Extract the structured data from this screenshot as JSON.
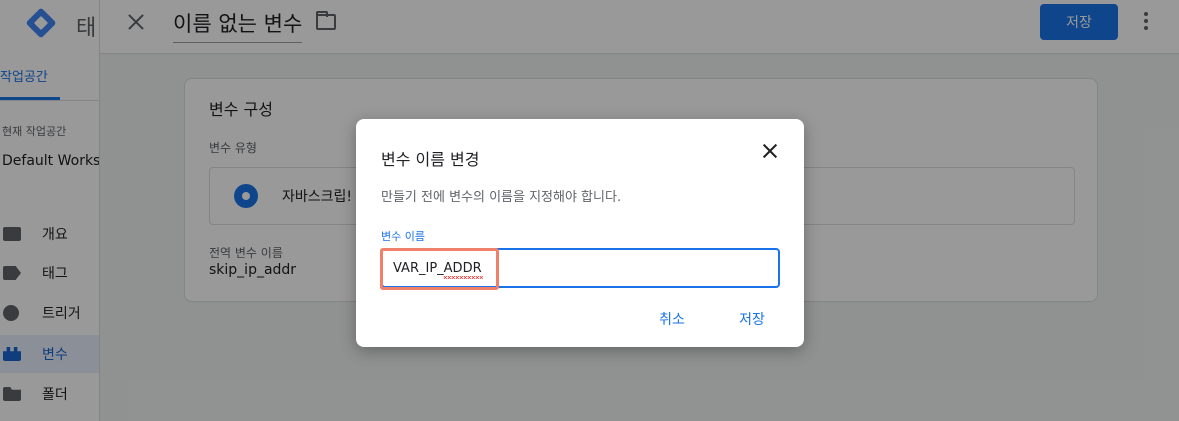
{
  "sidebar": {
    "title": "태",
    "workspace_tab": "작업공간",
    "current_workspace_label": "현재 작업공간",
    "workspace_name": "Default Worksp",
    "items": [
      {
        "label": "개요",
        "icon": "overview-icon"
      },
      {
        "label": "태그",
        "icon": "tag-icon"
      },
      {
        "label": "트리거",
        "icon": "trigger-icon"
      },
      {
        "label": "변수",
        "icon": "variable-icon",
        "active": true
      },
      {
        "label": "폴더",
        "icon": "folder-icon"
      }
    ]
  },
  "topbar": {
    "title": "이름 없는 변수",
    "save_label": "저장",
    "accent": "#1a73e8"
  },
  "card": {
    "title": "변수 구성",
    "type_label": "변수 유형",
    "type_name": "자바스크립!",
    "global_name_label": "전역 변수 이름",
    "global_name_value": "skip_ip_addr"
  },
  "dialog": {
    "title": "변수 이름 변경",
    "description": "만들기 전에 변수의 이름을 지정해야 합니다.",
    "field_label": "변수 이름",
    "field_value": "VAR_IP_ADDR",
    "cancel_label": "취소",
    "save_label": "저장",
    "highlight_color": "#f0806a"
  }
}
